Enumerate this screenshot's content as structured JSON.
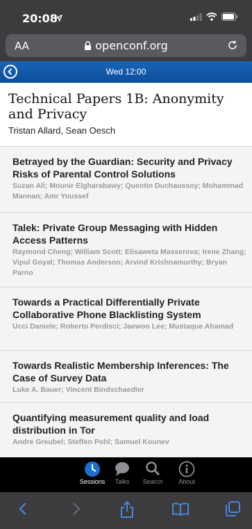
{
  "status": {
    "time": "20:08"
  },
  "browser": {
    "text_size": "AA",
    "domain": "openconf.org"
  },
  "header": {
    "title": "Wed 12:00"
  },
  "session": {
    "title": "Technical Papers 1B: Anonymity and Privacy",
    "chairs": "Tristan Allard, Sean Oesch"
  },
  "papers": [
    {
      "title": "Betrayed by the Guardian: Security and Privacy Risks of Parental Control Solutions",
      "authors": "Suzan Ali; Mounir Elgharabawy; Quentin Duchaussoy; Mohammad Mannan; Amr Youssef"
    },
    {
      "title": "Talek: Private Group Messaging with Hidden Access Patterns",
      "authors": "Raymond Cheng; William Scott; Elisaweta Masserova; Irene Zhang; Vipul Goyal; Thomas Anderson; Arvind Krishnamurthy; Bryan Parno"
    },
    {
      "title": "Towards a Practical Differentially Private Collaborative Phone Blacklisting System",
      "authors": "Ucci Daniele; Roberto Perdisci; Jaewoo Lee; Mustaque Ahamad"
    },
    {
      "title": "Towards Realistic Membership Inferences: The Case of Survey Data",
      "authors": "Luke A. Bauer; Vincent Bindschaedler"
    },
    {
      "title": "Quantifying measurement quality and load distribution in Tor",
      "authors": "Andre Greubel; Steffen Pohl; Samuel Kounev"
    }
  ],
  "tabs": {
    "sessions": "Sessions",
    "talks": "Talks",
    "search": "Search",
    "about": "About"
  },
  "colors": {
    "header_blue": "#1a63b6",
    "active_tab": "#1a6fd1"
  }
}
